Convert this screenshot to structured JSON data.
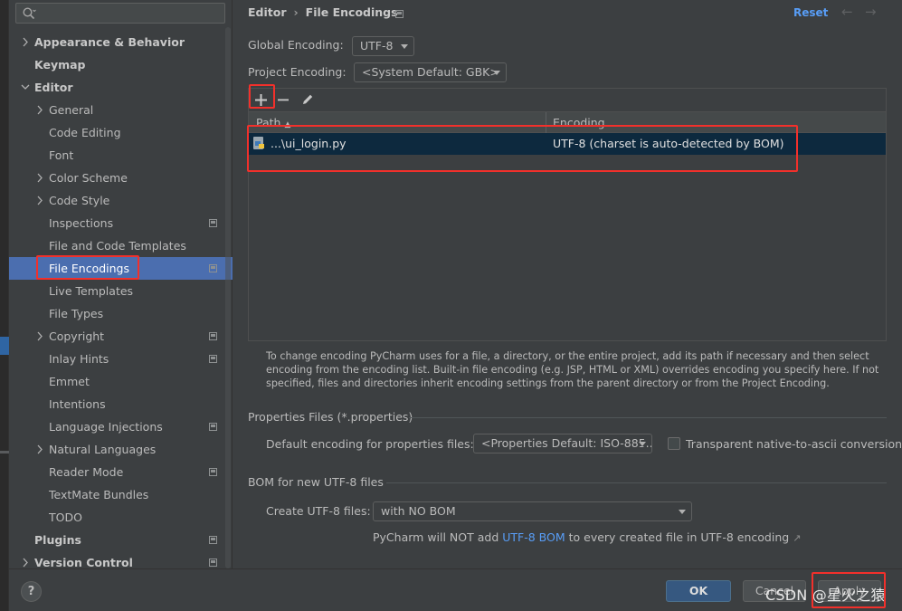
{
  "sidebar": {
    "search_placeholder": "",
    "items": [
      {
        "label": "Appearance & Behavior",
        "level": 0,
        "expandable": true,
        "expanded": false,
        "bold": true,
        "project": false
      },
      {
        "label": "Keymap",
        "level": 0,
        "expandable": false,
        "bold": true,
        "project": false
      },
      {
        "label": "Editor",
        "level": 0,
        "expandable": true,
        "expanded": true,
        "bold": true,
        "project": false
      },
      {
        "label": "General",
        "level": 1,
        "expandable": true,
        "expanded": false,
        "bold": false,
        "project": false
      },
      {
        "label": "Code Editing",
        "level": 1,
        "expandable": false,
        "bold": false,
        "project": false
      },
      {
        "label": "Font",
        "level": 1,
        "expandable": false,
        "bold": false,
        "project": false
      },
      {
        "label": "Color Scheme",
        "level": 1,
        "expandable": true,
        "expanded": false,
        "bold": false,
        "project": false
      },
      {
        "label": "Code Style",
        "level": 1,
        "expandable": true,
        "expanded": false,
        "bold": false,
        "project": false
      },
      {
        "label": "Inspections",
        "level": 1,
        "expandable": false,
        "bold": false,
        "project": true
      },
      {
        "label": "File and Code Templates",
        "level": 1,
        "expandable": false,
        "bold": false,
        "project": false
      },
      {
        "label": "File Encodings",
        "level": 1,
        "expandable": false,
        "bold": false,
        "project": true,
        "selected": true
      },
      {
        "label": "Live Templates",
        "level": 1,
        "expandable": false,
        "bold": false,
        "project": false
      },
      {
        "label": "File Types",
        "level": 1,
        "expandable": false,
        "bold": false,
        "project": false
      },
      {
        "label": "Copyright",
        "level": 1,
        "expandable": true,
        "expanded": false,
        "bold": false,
        "project": true
      },
      {
        "label": "Inlay Hints",
        "level": 1,
        "expandable": false,
        "bold": false,
        "project": true
      },
      {
        "label": "Emmet",
        "level": 1,
        "expandable": false,
        "bold": false,
        "project": false
      },
      {
        "label": "Intentions",
        "level": 1,
        "expandable": false,
        "bold": false,
        "project": false
      },
      {
        "label": "Language Injections",
        "level": 1,
        "expandable": false,
        "bold": false,
        "project": true
      },
      {
        "label": "Natural Languages",
        "level": 1,
        "expandable": true,
        "expanded": false,
        "bold": false,
        "project": false
      },
      {
        "label": "Reader Mode",
        "level": 1,
        "expandable": false,
        "bold": false,
        "project": true
      },
      {
        "label": "TextMate Bundles",
        "level": 1,
        "expandable": false,
        "bold": false,
        "project": false
      },
      {
        "label": "TODO",
        "level": 1,
        "expandable": false,
        "bold": false,
        "project": false
      },
      {
        "label": "Plugins",
        "level": 0,
        "expandable": false,
        "bold": true,
        "project": true
      },
      {
        "label": "Version Control",
        "level": 0,
        "expandable": true,
        "expanded": false,
        "bold": true,
        "project": true
      }
    ]
  },
  "header": {
    "crumb_parent": "Editor",
    "crumb_separator": "›",
    "crumb_current": "File Encodings",
    "reset_label": "Reset"
  },
  "global_encoding": {
    "label": "Global Encoding:",
    "value": "UTF-8"
  },
  "project_encoding": {
    "label": "Project Encoding:",
    "value": "<System Default: GBK>"
  },
  "table": {
    "col_path": "Path",
    "col_encoding": "Encoding",
    "rows": [
      {
        "path": "...\\ui_login.py",
        "encoding": "UTF-8 (charset is auto-detected by BOM)"
      }
    ]
  },
  "hint_text": "To change encoding PyCharm uses for a file, a directory, or the entire project, add its path if necessary and then select encoding from the encoding list. Built-in file encoding (e.g. JSP, HTML or XML) overrides encoding you specify here. If not specified, files and directories inherit encoding settings from the parent directory or from the Project Encoding.",
  "properties": {
    "group_title": "Properties Files (*.properties)",
    "default_label": "Default encoding for properties files:",
    "default_value": "<Properties Default: ISO-885...",
    "transparent_label": "Transparent native-to-ascii conversion",
    "transparent_checked": false
  },
  "bom": {
    "group_title": "BOM for new UTF-8 files",
    "create_label": "Create UTF-8 files:",
    "create_value": "with NO BOM",
    "note_prefix": "PyCharm will NOT add ",
    "note_link": "UTF-8 BOM",
    "note_suffix": " to every created file in UTF-8 encoding",
    "note_ext": "↗"
  },
  "footer": {
    "help_label": "?",
    "ok_label": "OK",
    "cancel_label": "Cancel",
    "apply_label": "Apply"
  },
  "watermark": "CSDN @星火之猿",
  "colors": {
    "selection": "#4b6eaf",
    "link": "#589df6",
    "highlight_box": "#f2302b",
    "table_selected_row": "#0d293e"
  }
}
